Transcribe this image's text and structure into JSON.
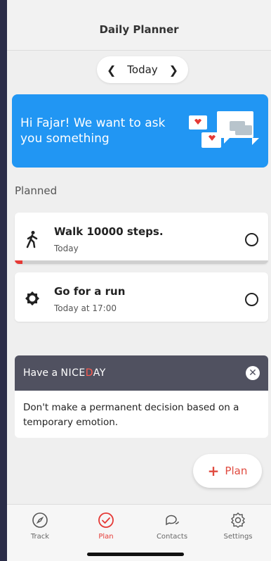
{
  "header": {
    "title": "Daily Planner"
  },
  "date_nav": {
    "label": "Today"
  },
  "banner": {
    "text": "Hi Fajar! We want to ask you something"
  },
  "planned": {
    "title": "Planned",
    "items": [
      {
        "title": "Walk 10000 steps.",
        "subtitle": "Today",
        "icon": "walking-person-icon",
        "progress": 0.03
      },
      {
        "title": "Go for a run",
        "subtitle": "Today at 17:00",
        "icon": "gear-icon"
      }
    ]
  },
  "quote_card": {
    "prefix": "Have a ",
    "brand_a": "NICE",
    "brand_b": "D",
    "brand_c": "AY",
    "quote": "Don't make a permanent decision based on a temporary emotion."
  },
  "fab": {
    "label": "Plan"
  },
  "tabs": [
    {
      "label": "Track",
      "icon": "compass-icon"
    },
    {
      "label": "Plan",
      "icon": "check-circle-icon",
      "active": true
    },
    {
      "label": "Contacts",
      "icon": "chat-bubbles-icon"
    },
    {
      "label": "Settings",
      "icon": "gear-icon"
    }
  ],
  "colors": {
    "accent": "#e53935",
    "banner": "#2196f3",
    "quote_header": "#505160"
  }
}
